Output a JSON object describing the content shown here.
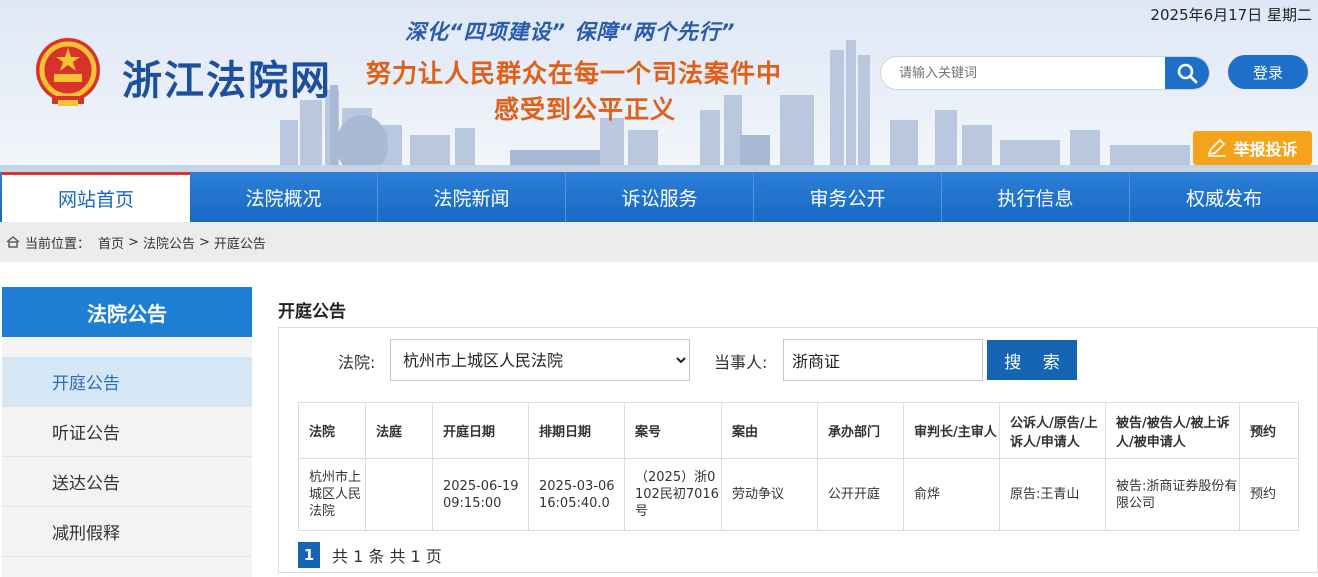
{
  "header": {
    "site_title": "浙江法院网",
    "slogan_line1": "深化“四项建设” 保障“两个先行”",
    "slogan_line2": "努力让人民群众在每一个司法案件中",
    "slogan_line3": "感受到公平正义",
    "date": "2025年6月17日 星期二",
    "search_placeholder": "请输入关键词",
    "login_label": "登录",
    "report_label": "举报投诉"
  },
  "nav": {
    "items": [
      {
        "label": "网站首页"
      },
      {
        "label": "法院概况"
      },
      {
        "label": "法院新闻"
      },
      {
        "label": "诉讼服务"
      },
      {
        "label": "审务公开"
      },
      {
        "label": "执行信息"
      },
      {
        "label": "权威发布"
      }
    ],
    "active_index": 0
  },
  "breadcrumb": {
    "prefix": "当前位置：",
    "items": [
      "首页",
      "法院公告",
      "开庭公告"
    ]
  },
  "sidebar": {
    "title": "法院公告",
    "items": [
      {
        "label": "开庭公告"
      },
      {
        "label": "听证公告"
      },
      {
        "label": "送达公告"
      },
      {
        "label": "减刑假释"
      }
    ],
    "active_index": 0
  },
  "main": {
    "title": "开庭公告",
    "court_label": "法院:",
    "court_value": "杭州市上城区人民法院",
    "party_label": "当事人:",
    "party_value": "浙商证",
    "search_label": "搜 索"
  },
  "table": {
    "headers": [
      "法院",
      "法庭",
      "开庭日期",
      "排期日期",
      "案号",
      "案由",
      "承办部门",
      "审判长/主审人",
      "公诉人/原告/上诉人/申请人",
      "被告/被告人/被上诉人/被申请人",
      "预约"
    ],
    "rows": [
      [
        "杭州市上城区人民法院",
        "",
        "2025-06-19 09:15:00",
        "2025-03-06 16:05:40.0",
        "（2025）浙0102民初7016号",
        "劳动争议",
        "公开开庭",
        "俞烨",
        "原告:王青山",
        "被告:浙商证券股份有限公司",
        "预约"
      ]
    ]
  },
  "pager": {
    "current": "1",
    "summary": "共 1 条 共 1 页"
  },
  "colors": {
    "primary_blue": "#1769c3",
    "accent_orange": "#e0601a",
    "report_yellow": "#f5a31a"
  }
}
